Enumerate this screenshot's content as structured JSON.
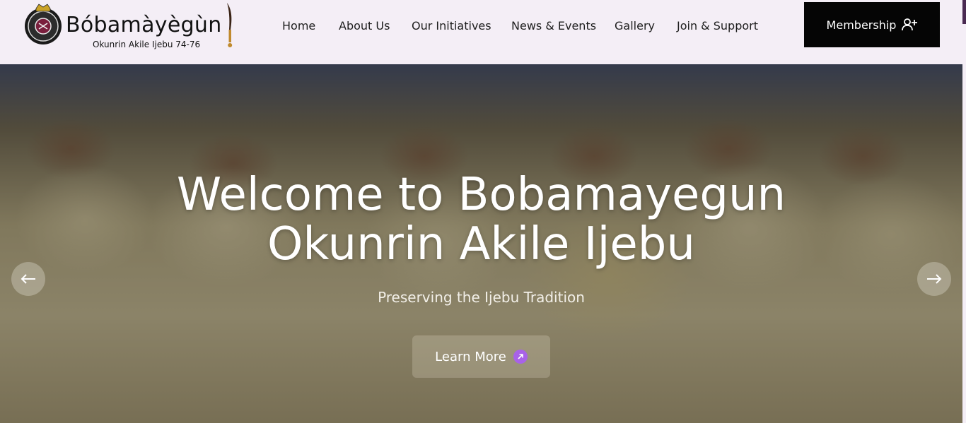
{
  "brand": {
    "name": "Bóbamàyègùn",
    "subtitle": "Okunrin Akile Ijebu 74-76"
  },
  "nav": {
    "items": [
      {
        "label": "Home"
      },
      {
        "label": "About Us"
      },
      {
        "label": "Our Initiatives"
      },
      {
        "label": "News & Events"
      },
      {
        "label": "Gallery"
      },
      {
        "label": "Join & Support"
      }
    ]
  },
  "membership": {
    "label": "Membership",
    "icon": "user-plus-icon"
  },
  "hero": {
    "title_line1": "Welcome to Bobamayegun",
    "title_line2": "Okunrin Akile Ijebu",
    "subtitle": "Preserving the Ijebu Tradition",
    "cta_label": "Learn More",
    "cta_icon": "arrow-up-right-icon",
    "prev_icon": "arrow-left-icon",
    "next_icon": "arrow-right-icon"
  },
  "colors": {
    "header_bg": "#f4eef6",
    "button_dark": "#050505",
    "accent_purple": "#a862e8"
  }
}
